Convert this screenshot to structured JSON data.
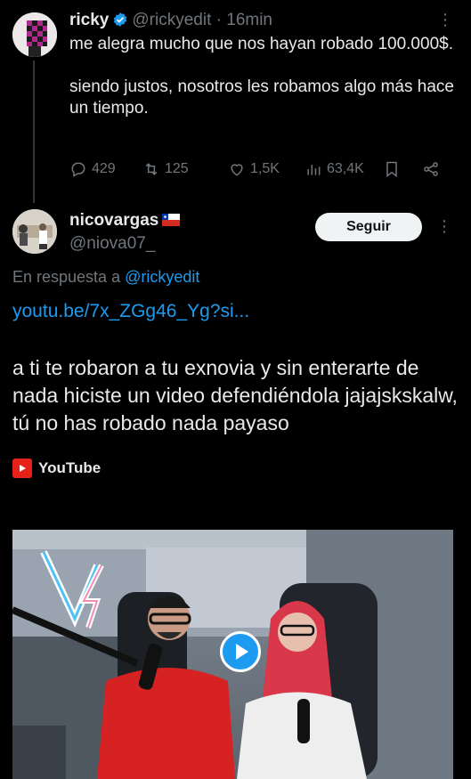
{
  "tweet1": {
    "name": "ricky",
    "handle": "@rickyedit",
    "time": "· 16min",
    "more": "⋮",
    "text_line1": "me alegra mucho que nos hayan robado 100.000$.",
    "text_line2": "siendo justos, nosotros les robamos algo más hace un tiempo.",
    "replies": "429",
    "reposts": "125",
    "likes": "1,5K",
    "views": "63,4K"
  },
  "tweet2": {
    "name": "nicovargas",
    "handle": "@niova07_",
    "follow_label": "Seguir",
    "more": "⋮",
    "reply_prefix": "En respuesta a ",
    "reply_handle": "@rickyedit",
    "link": "youtu.be/7x_ZGg46_Yg?si...",
    "text": "a ti te robaron a tu exnovia y sin enterarte de nada hiciste un video defendiéndola jajajskskalw, tú no has robado nada payaso",
    "card_source": "YouTube"
  },
  "colors": {
    "background": "#000000",
    "text": "#e7e9ea",
    "muted": "#71767b",
    "link": "#1d9bf0",
    "youtube_red": "#e62117"
  }
}
